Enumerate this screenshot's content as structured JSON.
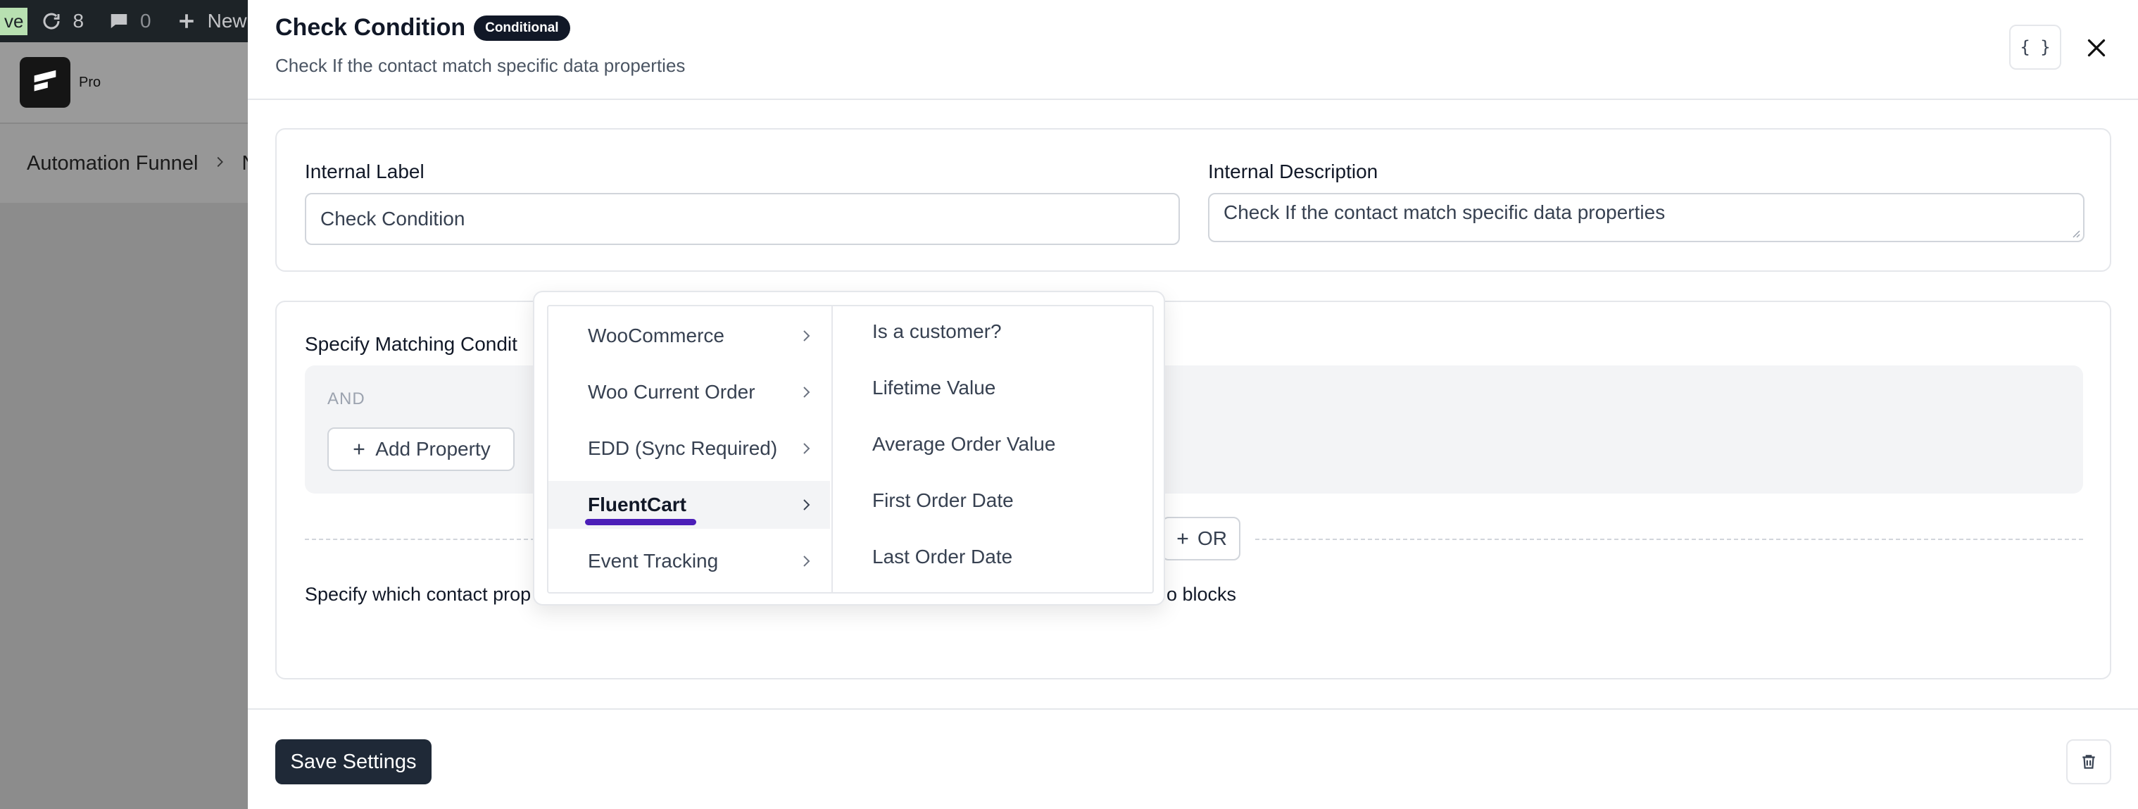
{
  "background": {
    "adminbar": {
      "live_badge": "ve",
      "updates_count": "8",
      "comments_count": "0",
      "new_label": "New"
    },
    "brand": {
      "pro_label": "Pro"
    },
    "breadcrumb": {
      "first": "Automation Funnel",
      "second_partial": "N"
    }
  },
  "drawer": {
    "title": "Check Condition",
    "badge": "Conditional",
    "subtitle": "Check If the contact match specific data properties",
    "json_button_label": "{ }",
    "internal_label": {
      "label": "Internal Label",
      "value": "Check Condition"
    },
    "internal_description": {
      "label": "Internal Description",
      "value": "Check If the contact match specific data properties"
    },
    "conditions": {
      "title_partial": "Specify Matching Condit",
      "and_label": "AND",
      "add_property_label": "Add Property",
      "or_label": "OR",
      "help_left": "Specify which contact prop",
      "help_right": "o blocks"
    },
    "footer": {
      "save_label": "Save Settings"
    }
  },
  "dropdown": {
    "categories": [
      {
        "label": "WooCommerce",
        "active": false
      },
      {
        "label": "Woo Current Order",
        "active": false
      },
      {
        "label": "EDD (Sync Required)",
        "active": false
      },
      {
        "label": "FluentCart",
        "active": true
      },
      {
        "label": "Event Tracking",
        "active": false
      }
    ],
    "options": [
      "Is a customer?",
      "Lifetime Value",
      "Average Order Value",
      "First Order Date",
      "Last Order Date"
    ]
  },
  "colors": {
    "primary_dark": "#1f2937",
    "active_underline": "#4c1fb8",
    "badge_bg": "#111827"
  }
}
